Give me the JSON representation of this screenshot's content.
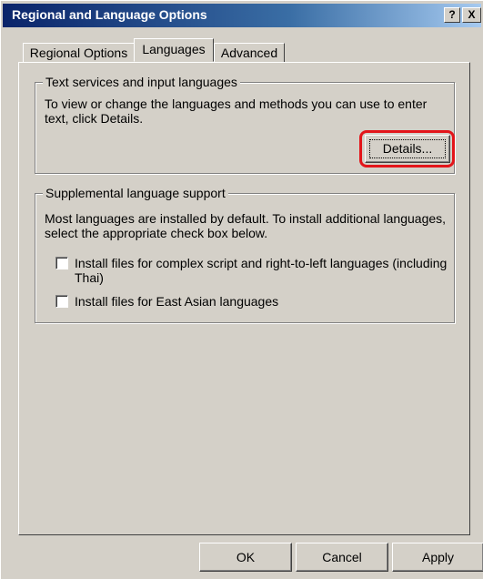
{
  "window": {
    "title": "Regional and Language Options",
    "help_icon": "?",
    "close_icon": "X"
  },
  "tabs": [
    {
      "label": "Regional Options",
      "active": false
    },
    {
      "label": "Languages",
      "active": true
    },
    {
      "label": "Advanced",
      "active": false
    }
  ],
  "text_services": {
    "legend": "Text services and input languages",
    "description": "To view or change the languages and methods you can use to enter text, click Details.",
    "details_button": "Details..."
  },
  "supplemental": {
    "legend": "Supplemental language support",
    "description": "Most languages are installed by default. To install additional languages, select the appropriate check box below.",
    "checkboxes": [
      {
        "label": "Install files for complex script and right-to-left languages (including Thai)",
        "checked": false
      },
      {
        "label": "Install files for East Asian languages",
        "checked": false
      }
    ]
  },
  "buttons": {
    "ok": "OK",
    "cancel": "Cancel",
    "apply": "Apply"
  },
  "colors": {
    "highlight": "#e3151a",
    "titlebar": "#0a246a",
    "face": "#d4d0c8"
  }
}
